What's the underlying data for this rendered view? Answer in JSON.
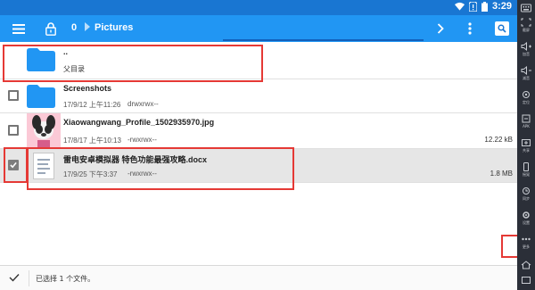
{
  "status_bar": {
    "time": "3:29"
  },
  "toolbar": {
    "file_count": "0",
    "breadcrumb": "Pictures"
  },
  "parent_row": {
    "name": "..",
    "subtitle": "父目录"
  },
  "files": [
    {
      "name": "Screenshots",
      "date": "17/9/12 上午11:26",
      "perms": "drwxrwx--",
      "size": "",
      "type": "folder",
      "checked": false
    },
    {
      "name": "Xiaowangwang_Profile_1502935970.jpg",
      "date": "17/8/17 上午10:13",
      "perms": "-rwxrwx--",
      "size": "12.22 kB",
      "type": "image",
      "checked": false
    },
    {
      "name": "雷电安卓模拟器 特色功能最强攻略.docx",
      "date": "17/9/25 下午3:37",
      "perms": "-rwxrwx--",
      "size": "1.8 MB",
      "type": "document",
      "checked": true
    }
  ],
  "bottom_bar": {
    "message": "已选择 1 个文件。"
  },
  "side_panel": {
    "buttons": [
      {
        "label": "截屏",
        "icon": "screenshot-icon"
      },
      {
        "label": "加音",
        "icon": "volume-up-icon"
      },
      {
        "label": "减音",
        "icon": "volume-down-icon"
      },
      {
        "label": "定位",
        "icon": "location-icon"
      },
      {
        "label": "APK",
        "icon": "apk-icon"
      },
      {
        "label": "共享",
        "icon": "share-icon"
      },
      {
        "label": "摇晃",
        "icon": "shake-icon"
      },
      {
        "label": "同步",
        "icon": "sync-icon"
      },
      {
        "label": "设置",
        "icon": "settings-icon"
      },
      {
        "label": "更多",
        "icon": "more-icon"
      }
    ]
  },
  "colors": {
    "toolbar": "#2196f3",
    "status_bar": "#1976d2",
    "folder": "#2196f3",
    "annotation": "#e53935",
    "side_panel": "#2b2f38"
  }
}
